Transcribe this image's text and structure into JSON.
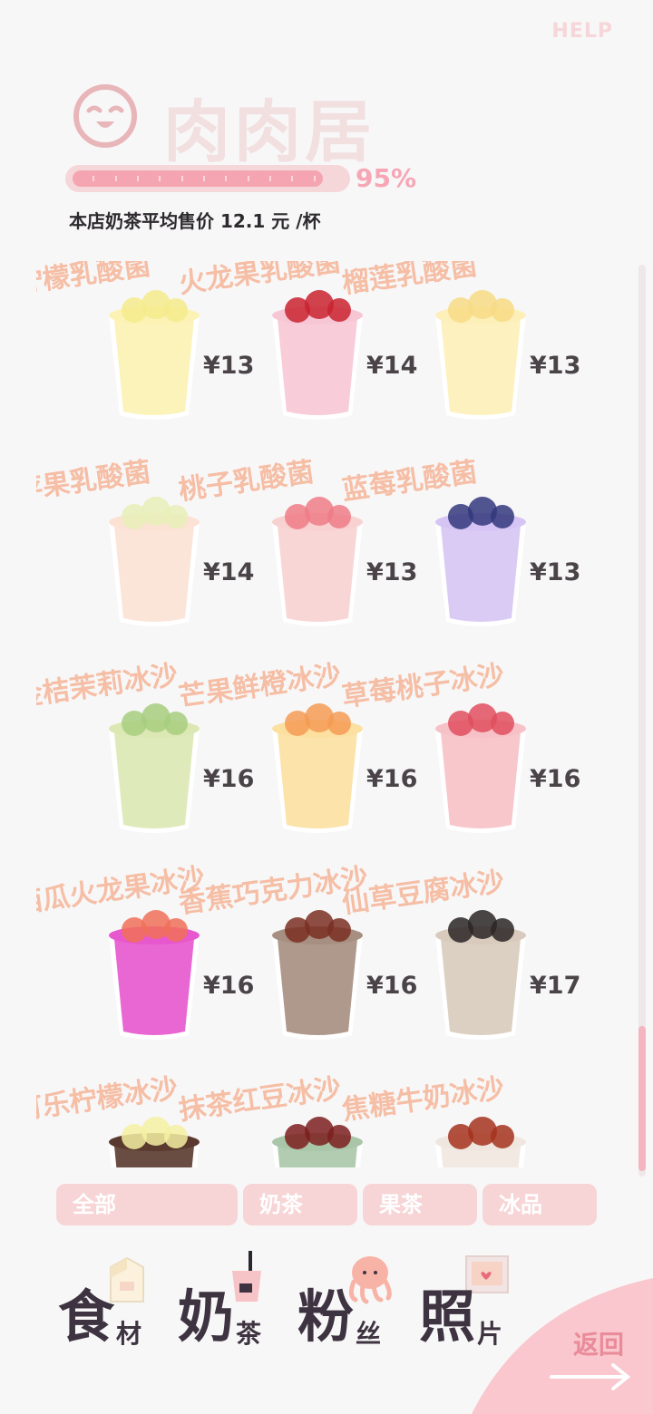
{
  "header": {
    "help_label": "HELP",
    "shop_name": "肉肉居",
    "progress_percent": 95,
    "progress_label": "95%",
    "avg_price_text": "本店奶茶平均售价  12.1 元 /杯"
  },
  "menu": {
    "rows": [
      [
        {
          "name": "柠檬乳酸菌",
          "price": "¥13",
          "color": "#fbf2b3",
          "topping": "#f5eb8c"
        },
        {
          "name": "火龙果乳酸菌",
          "price": "¥14",
          "color": "#f7c6d5",
          "topping": "#c9232f"
        },
        {
          "name": "榴莲乳酸菌",
          "price": "¥13",
          "color": "#fcefb8",
          "topping": "#f7db85"
        }
      ],
      [
        {
          "name": "苹果乳酸菌",
          "price": "¥14",
          "color": "#fbe2d4",
          "topping": "#e7efb7"
        },
        {
          "name": "桃子乳酸菌",
          "price": "¥13",
          "color": "#f8d1d1",
          "topping": "#ee7d86"
        },
        {
          "name": "蓝莓乳酸菌",
          "price": "¥13",
          "color": "#d6c5f4",
          "topping": "#33377c"
        }
      ],
      [
        {
          "name": "金桔茉莉冰沙",
          "price": "¥16",
          "color": "#dce8b4",
          "topping": "#a7ce7f"
        },
        {
          "name": "芒果鲜橙冰沙",
          "price": "¥16",
          "color": "#fbe0a0",
          "topping": "#f49b55"
        },
        {
          "name": "草莓桃子冰沙",
          "price": "¥16",
          "color": "#f6c1c7",
          "topping": "#e14f5e"
        }
      ],
      [
        {
          "name": "西瓜火龙果冰沙",
          "price": "¥16",
          "color": "#e757ce",
          "topping": "#f07058"
        },
        {
          "name": "香蕉巧克力冰沙",
          "price": "¥16",
          "color": "#a68e80",
          "topping": "#7a2f22"
        },
        {
          "name": "仙草豆腐冰沙",
          "price": "¥17",
          "color": "#d8cbbd",
          "topping": "#2b2626"
        }
      ],
      [
        {
          "name": "可乐柠檬冰沙",
          "price": "",
          "color": "#5a3a2e",
          "topping": "#f4f0a2"
        },
        {
          "name": "抹茶红豆冰沙",
          "price": "",
          "color": "#a9c6a9",
          "topping": "#7d1f1f"
        },
        {
          "name": "焦糖牛奶冰沙",
          "price": "",
          "color": "#efe7df",
          "topping": "#a4321f"
        }
      ]
    ]
  },
  "filters": [
    "全部",
    "奶茶",
    "果茶",
    "冰品"
  ],
  "nav": [
    {
      "big": "食",
      "small": "材",
      "icon": "milk-carton-icon"
    },
    {
      "big": "奶",
      "small": "茶",
      "icon": "milk-tea-cup-icon"
    },
    {
      "big": "粉",
      "small": "丝",
      "icon": "octopus-icon"
    },
    {
      "big": "照",
      "small": "片",
      "icon": "photo-frame-icon"
    }
  ],
  "back_label": "返回",
  "colors": {
    "accent_pink": "#f5a5b2",
    "name_orange": "#f5b89d",
    "dark_text": "#3e3340"
  }
}
